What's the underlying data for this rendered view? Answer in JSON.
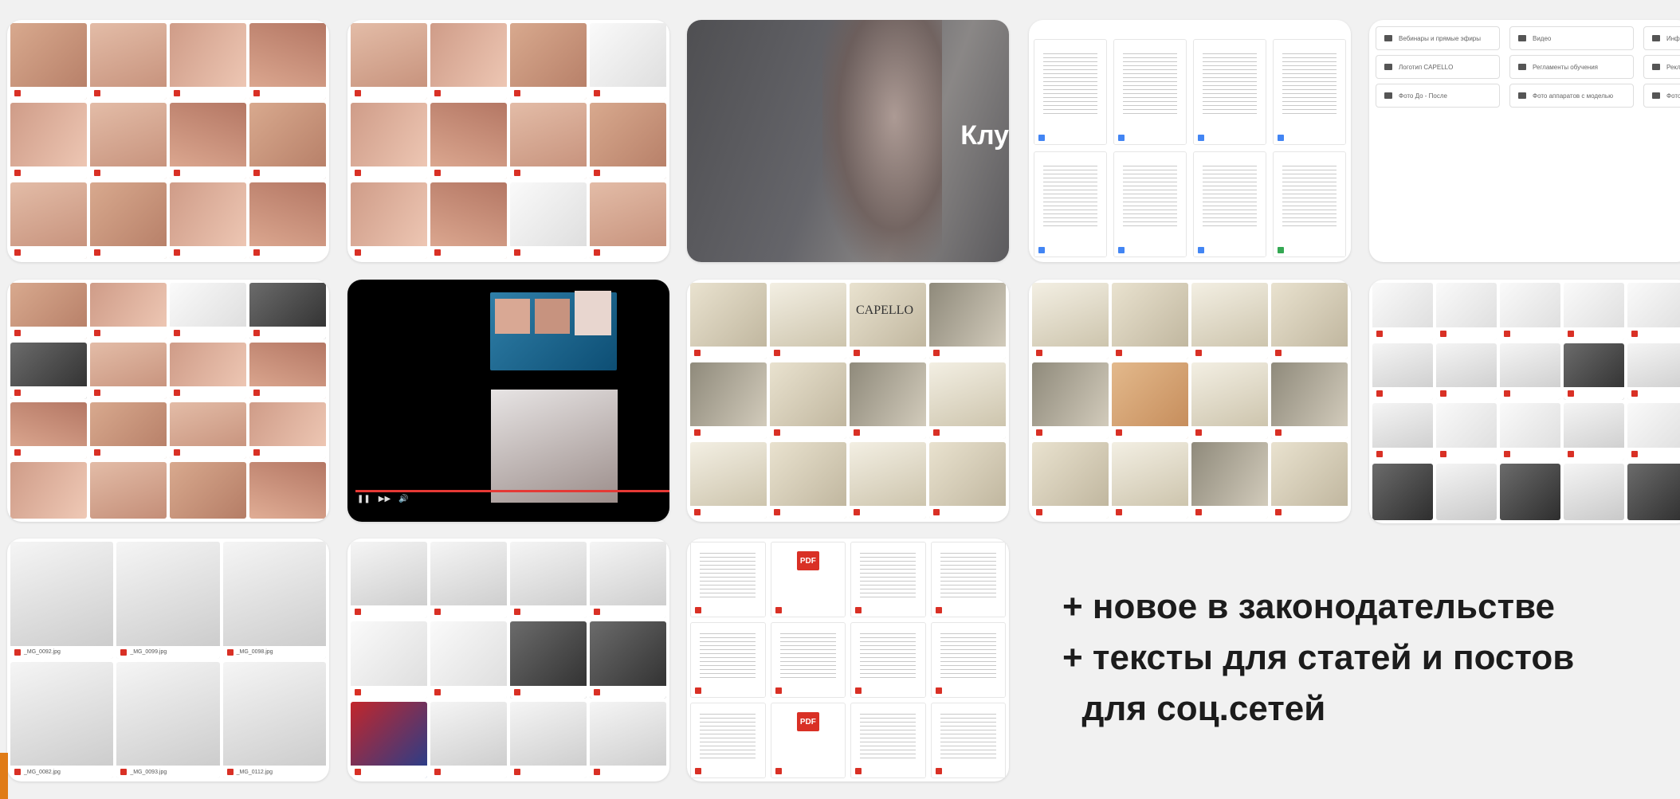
{
  "bullets": [
    "+ новое в законодательстве",
    "+ тексты для статей и постов",
    "  для соц.сетей"
  ],
  "video_banner": {
    "title_fragment": "Клу"
  },
  "folders": [
    "Вебинары и прямые эфиры",
    "Видео",
    "Инфографика",
    "Логотип CAPELLO",
    "Регламенты обучения",
    "Рекламные",
    "Фото До - После",
    "Фото аппаратов с моделью",
    "Фото моделей"
  ],
  "brand_label": "CAPELLO",
  "pdf_label": "PDF",
  "file_names": {
    "row3_card1": [
      "_MG_0092.jpg",
      "_MG_0099.jpg",
      "_MG_0098.jpg",
      "_MG_0082.jpg",
      "_MG_0093.jpg",
      "_MG_0112.jpg"
    ]
  },
  "colors": {
    "background": "#f1f1f1",
    "accent_orange": "#e07b16",
    "pdf_red": "#d93025",
    "video_progress": "#e53935"
  }
}
